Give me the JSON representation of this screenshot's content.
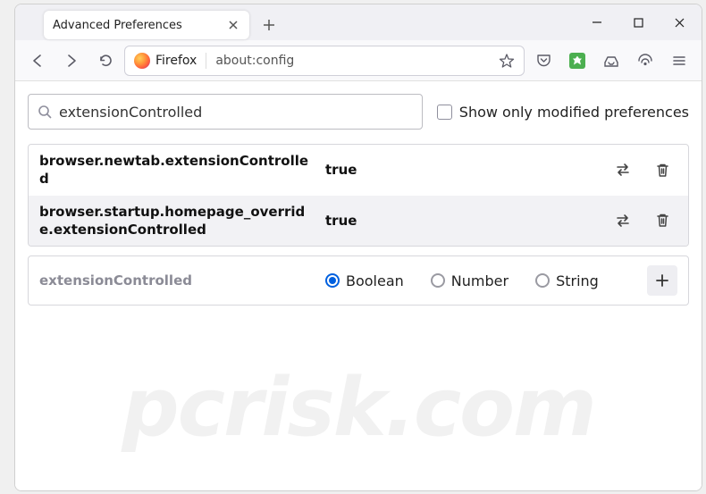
{
  "window": {
    "tab_title": "Advanced Preferences"
  },
  "url": {
    "prefix": "Firefox",
    "value": "about:config"
  },
  "search": {
    "value": "extensionControlled"
  },
  "filter": {
    "label": "Show only modified preferences"
  },
  "prefs": [
    {
      "name": "browser.newtab.extensionControlled",
      "value": "true"
    },
    {
      "name": "browser.startup.homepage_override.extensionControlled",
      "value": "true"
    }
  ],
  "new_pref": {
    "name": "extensionControlled",
    "types": [
      "Boolean",
      "Number",
      "String"
    ],
    "selected": "Boolean"
  },
  "watermark": "pcrisk.com"
}
